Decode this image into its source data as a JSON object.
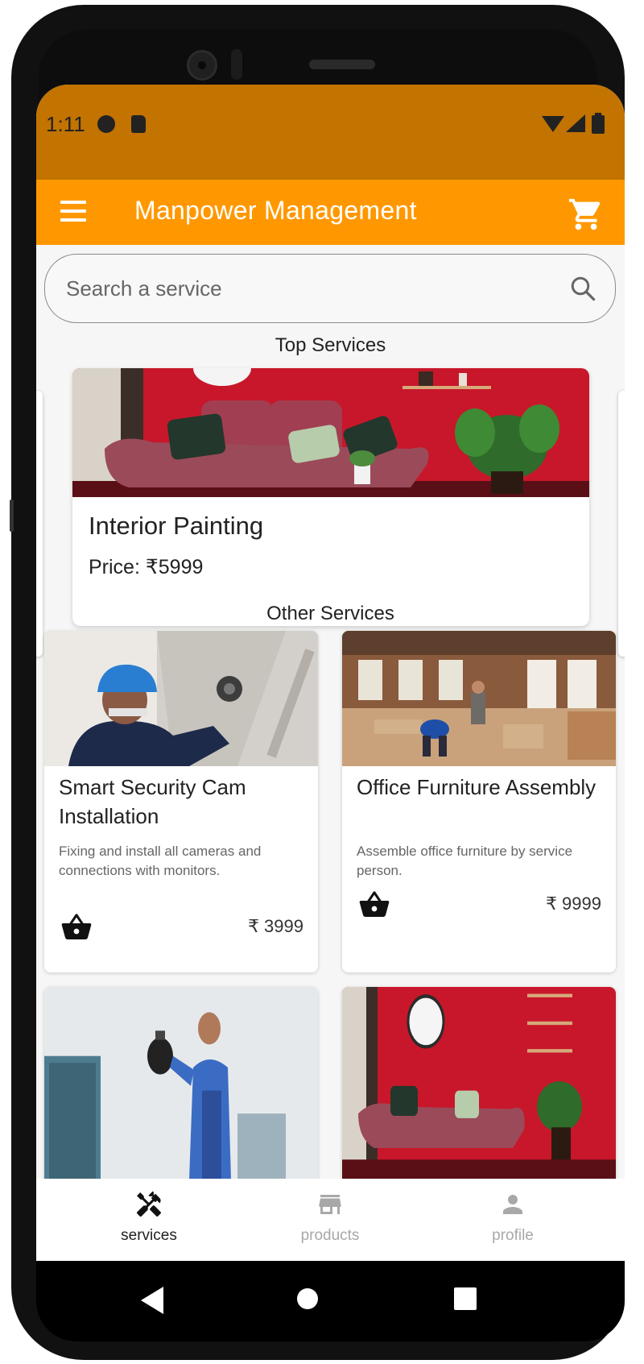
{
  "status_bar": {
    "time": "1:11"
  },
  "app_bar": {
    "title": "Manpower Management"
  },
  "search": {
    "placeholder": "Search a service"
  },
  "top_services": {
    "heading": "Top Services",
    "card": {
      "name": "Interior Painting",
      "price": "Price: ₹5999"
    }
  },
  "other_services": {
    "heading": "Other Services",
    "items": [
      {
        "title": "Smart Security Cam Installation",
        "description": "Fixing and install all cameras and connections with monitors.",
        "price": "₹ 3999"
      },
      {
        "title": "Office Furniture Assembly",
        "description": "Assemble office furniture by service person.",
        "price": "₹ 9999"
      }
    ]
  },
  "bottom_nav": {
    "items": [
      {
        "label": "services",
        "icon": "tools-icon",
        "active": true
      },
      {
        "label": "products",
        "icon": "store-icon",
        "active": false
      },
      {
        "label": "profile",
        "icon": "person-icon",
        "active": false
      }
    ]
  },
  "colors": {
    "status_bar": "#c27300",
    "app_bar": "#ff9800",
    "accent_wall": "#c8172a",
    "sofa": "#9b4a5a"
  }
}
